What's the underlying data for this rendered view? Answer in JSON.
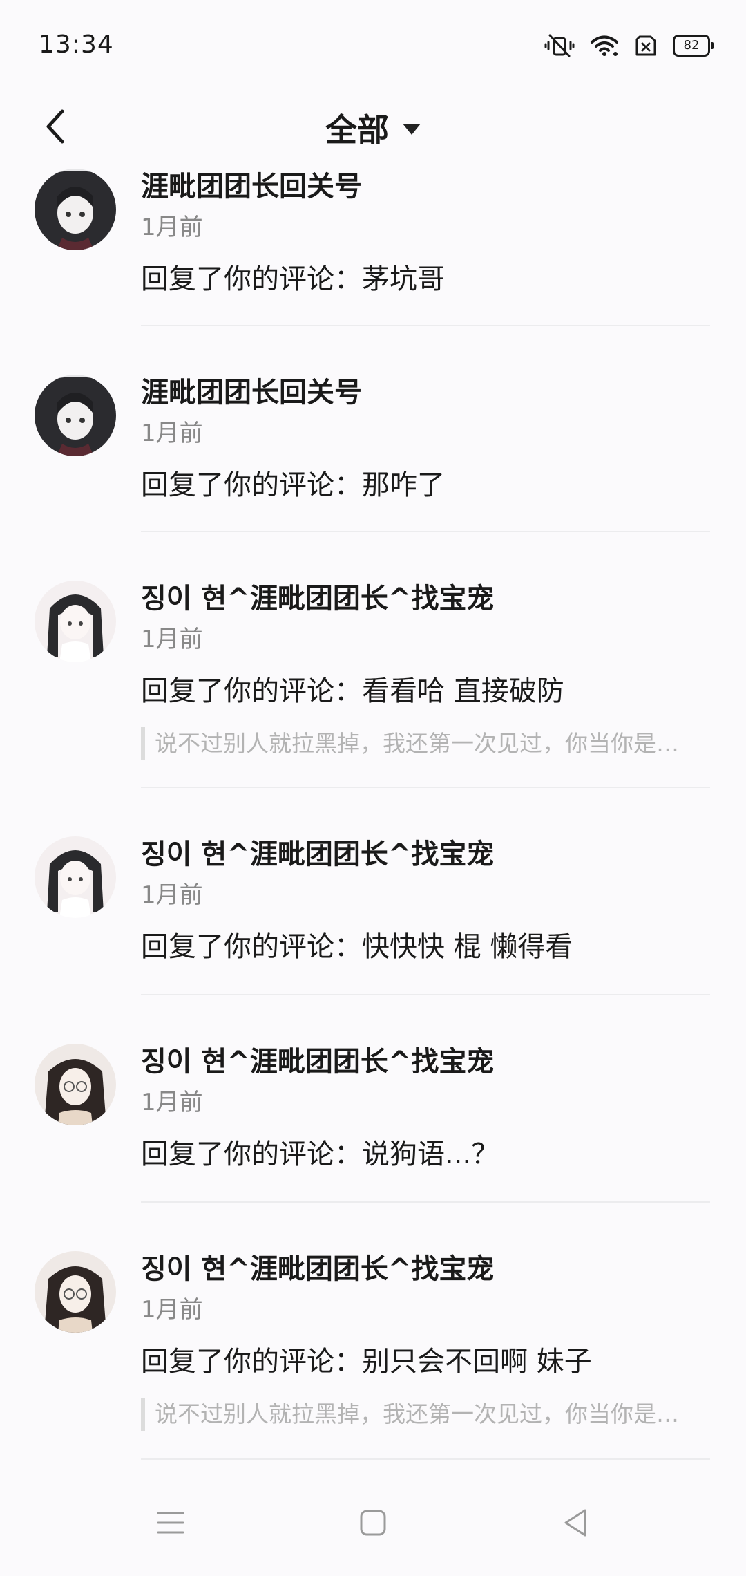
{
  "status_bar": {
    "time": "13:34",
    "battery": "82",
    "icons": [
      "vibrate-mute-icon",
      "wifi-icon",
      "sim-icon",
      "battery-icon"
    ]
  },
  "header": {
    "title": "全部",
    "back_icon": "back-chevron-icon",
    "dropdown_icon": "caret-down-icon"
  },
  "notifications": [
    {
      "name": "涯毗团团长回关号",
      "time": "1月前",
      "text": "回复了你的评论：茅坑哥",
      "quote": ""
    },
    {
      "name": "涯毗团团长回关号",
      "time": "1月前",
      "text": "回复了你的评论：那咋了",
      "quote": ""
    },
    {
      "name": "징이 현^涯毗团团长^找宝宠",
      "time": "1月前",
      "text": "回复了你的评论：看看哈 直接破防",
      "quote": "说不过别人就拉黑掉，我还第一次见过，你当你是…"
    },
    {
      "name": "징이 현^涯毗团团长^找宝宠",
      "time": "1月前",
      "text": "回复了你的评论：快快快 棍 懒得看",
      "quote": ""
    },
    {
      "name": "징이 현^涯毗团团长^找宝宠",
      "time": "1月前",
      "text": "回复了你的评论：说狗语...？",
      "quote": ""
    },
    {
      "name": "징이 현^涯毗团团长^找宝宠",
      "time": "1月前",
      "text": "回复了你的评论：别只会不回啊 妹子",
      "quote": "说不过别人就拉黑掉，我还第一次见过，你当你是…"
    }
  ],
  "nav_bar": {
    "icons": [
      "menu-icon",
      "home-square-icon",
      "back-triangle-icon"
    ]
  }
}
